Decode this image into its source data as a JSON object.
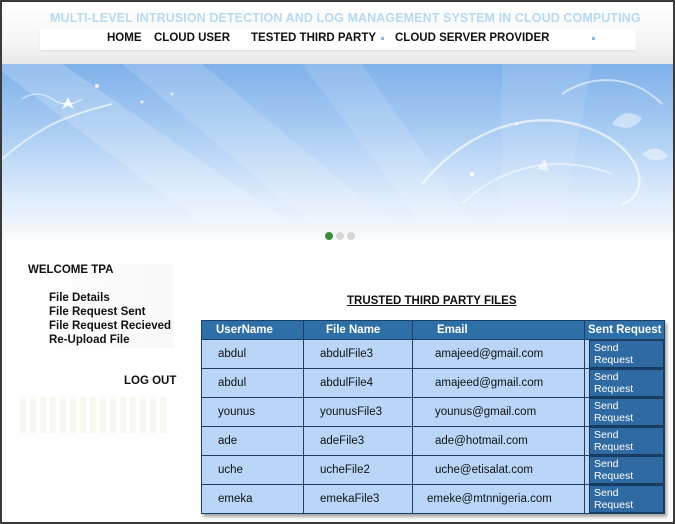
{
  "header": {
    "title": "MULTI-LEVEL INTRUSION DETECTION AND LOG MANAGEMENT SYSTEM IN CLOUD COMPUTING",
    "nav": [
      "HOME",
      "CLOUD USER",
      "TESTED THIRD PARTY",
      "CLOUD SERVER PROVIDER"
    ]
  },
  "sidebar": {
    "welcome": "WELCOME TPA",
    "links": [
      "File Details",
      "File Request Sent",
      "File Request Recieved",
      "Re-Upload File"
    ],
    "logout": "LOG OUT"
  },
  "table": {
    "title": "TRUSTED THIRD PARTY FILES",
    "headers": [
      "UserName",
      "File Name",
      "Email",
      "Sent Request"
    ],
    "rows": [
      {
        "username": "abdul",
        "file": "abdulFile3",
        "email": "amajeed@gmail.com",
        "action": "Send Request"
      },
      {
        "username": "abdul",
        "file": "abdulFile4",
        "email": "amajeed@gmail.com",
        "action": "Send Request"
      },
      {
        "username": "younus",
        "file": "younusFile3",
        "email": "younus@gmail.com",
        "action": "Send Request"
      },
      {
        "username": "ade",
        "file": "adeFile3",
        "email": "ade@hotmail.com",
        "action": "Send Request"
      },
      {
        "username": "uche",
        "file": "ucheFile2",
        "email": "uche@etisalat.com",
        "action": "Send Request"
      },
      {
        "username": "emeka",
        "file": "emekaFile3",
        "email": "emeke@mtnnigeria.com",
        "action": "Send Request"
      }
    ]
  },
  "colors": {
    "title_text": "#b7d9f1",
    "table_header": "#2f6fa7",
    "table_cell": "#b9d6f8",
    "button": "#2f6aa3",
    "active_dot": "#3e8a3e"
  }
}
